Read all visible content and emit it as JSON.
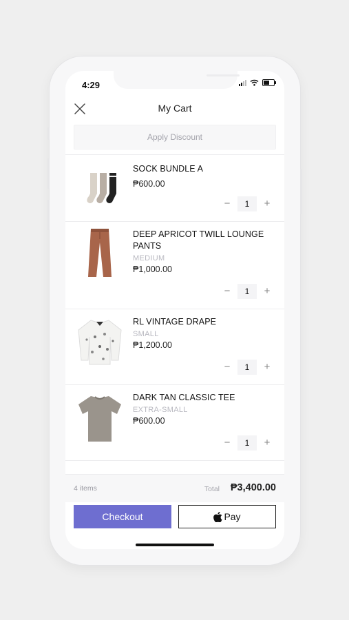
{
  "status_bar": {
    "time": "4:29"
  },
  "header": {
    "title": "My Cart"
  },
  "discount": {
    "label": "Apply Discount"
  },
  "items": [
    {
      "name": "SOCK BUNDLE A",
      "variant": "",
      "price": "₱600.00",
      "qty": "1"
    },
    {
      "name": "DEEP APRICOT TWILL LOUNGE PANTS",
      "variant": "MEDIUM",
      "price": "₱1,000.00",
      "qty": "1"
    },
    {
      "name": "RL VINTAGE DRAPE",
      "variant": "SMALL",
      "price": "₱1,200.00",
      "qty": "1"
    },
    {
      "name": "DARK TAN CLASSIC TEE",
      "variant": "EXTRA-SMALL",
      "price": "₱600.00",
      "qty": "1"
    }
  ],
  "qty_controls": {
    "minus": "−",
    "plus": "+"
  },
  "summary": {
    "count": "4 items",
    "total_label": "Total",
    "total_value": "₱3,400.00"
  },
  "buttons": {
    "checkout": "Checkout",
    "apple_pay": "Pay"
  },
  "colors": {
    "checkout_bg": "#6e6ed0",
    "background": "#efefef"
  }
}
